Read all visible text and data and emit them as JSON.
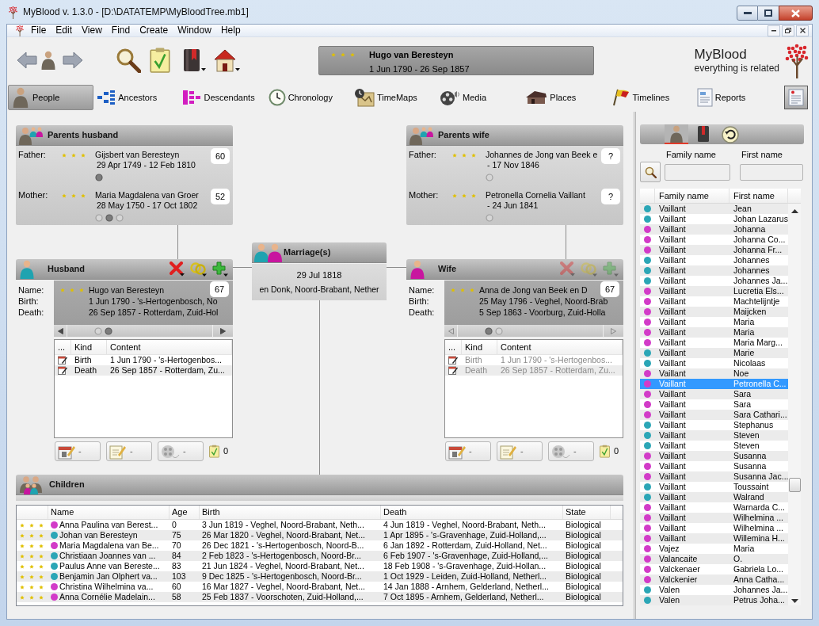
{
  "window": {
    "title": "MyBlood v. 1.3.0 - [D:\\DATATEMP\\MyBloodTree.mb1]"
  },
  "menu": [
    "File",
    "Edit",
    "View",
    "Find",
    "Create",
    "Window",
    "Help"
  ],
  "current_person": {
    "name": "Hugo van Beresteyn",
    "dates": "1 Jun 1790 - 26 Sep 1857"
  },
  "brand": {
    "name": "MyBlood",
    "tagline": "everything is related"
  },
  "tabs": [
    {
      "kind": "people",
      "label": "People",
      "selected": true
    },
    {
      "kind": "ancestors",
      "label": "Ancestors",
      "selected": false
    },
    {
      "kind": "descendants",
      "label": "Descendants",
      "selected": false
    },
    {
      "kind": "chronology",
      "label": "Chronology",
      "selected": false
    },
    {
      "kind": "timemaps",
      "label": "TimeMaps",
      "selected": false
    },
    {
      "kind": "media",
      "label": "Media",
      "selected": false
    },
    {
      "kind": "places",
      "label": "Places",
      "selected": false
    },
    {
      "kind": "timelines",
      "label": "Timelines",
      "selected": false
    },
    {
      "kind": "reports",
      "label": "Reports",
      "selected": false
    }
  ],
  "parents_husband": {
    "title": "Parents husband",
    "rows": [
      {
        "label": "Father:",
        "name": "Gijsbert van Beresteyn",
        "dates": "29 Apr 1749 - 12 Feb 1810",
        "age": "60",
        "pages": [
          {
            "selected": true
          }
        ]
      },
      {
        "label": "Mother:",
        "name": "Maria Magdalena van Groer",
        "dates": "28 May 1750 - 17 Oct 1802",
        "age": "52",
        "pages": [
          {
            "selected": false
          },
          {
            "selected": true
          },
          {
            "selected": false
          }
        ]
      }
    ]
  },
  "parents_wife": {
    "title": "Parents wife",
    "rows": [
      {
        "label": "Father:",
        "name": "Johannes de Jong van Beek e",
        "dates": "- 17 Nov 1846",
        "age": "?",
        "pages": [
          {
            "selected": false
          }
        ]
      },
      {
        "label": "Mother:",
        "name": "Petronella Cornelia Vaillant",
        "dates": "- 24 Jun 1841",
        "age": "?",
        "pages": [
          {
            "selected": false
          }
        ]
      }
    ]
  },
  "marriage": {
    "title": "Marriage(s)",
    "date": "29 Jul 1818",
    "place": "en Donk, Noord-Brabant, Nether"
  },
  "husband": {
    "title": "Husband",
    "disabled": false,
    "labels": [
      "Name:",
      "Birth:",
      "Death:"
    ],
    "lines": [
      "Hugo van Beresteyn",
      "1 Jun 1790 - 's-Hertogenbosch, No",
      "26 Sep 1857 - Rotterdam, Zuid-Hol"
    ],
    "age": "67",
    "pages": [
      {
        "selected": false
      },
      {
        "selected": true
      }
    ],
    "events": {
      "columns": [
        "...",
        "Kind",
        "Content"
      ],
      "rows": [
        {
          "event": "Birth",
          "content": "1 Jun 1790 - 's-Hertogenbos..."
        },
        {
          "event": "Death",
          "content": "26 Sep 1857 - Rotterdam, Zu..."
        }
      ]
    },
    "buttons": [
      {
        "kind": "event",
        "label": "-"
      },
      {
        "kind": "note",
        "label": "-"
      },
      {
        "kind": "media",
        "label": "-"
      }
    ],
    "tasks": "0"
  },
  "wife": {
    "title": "Wife",
    "disabled": true,
    "labels": [
      "Name:",
      "Birth:",
      "Death:"
    ],
    "lines": [
      "Anna de Jong van Beek en D",
      "25 May 1796 - Veghel, Noord-Brab",
      "5 Sep 1863 - Voorburg, Zuid-Holla"
    ],
    "age": "67",
    "pages": [
      {
        "selected": true
      },
      {
        "selected": false
      }
    ],
    "events": {
      "columns": [
        "...",
        "Kind",
        "Content"
      ],
      "rows": [
        {
          "event": "Birth",
          "content": "1 Jun 1790 - 's-Hertogenbos..."
        },
        {
          "event": "Death",
          "content": "26 Sep 1857 - Rotterdam, Zu..."
        }
      ]
    },
    "buttons": [
      {
        "kind": "event",
        "label": "-"
      },
      {
        "kind": "note",
        "label": "-"
      },
      {
        "kind": "media",
        "label": "-"
      }
    ],
    "tasks": "0"
  },
  "children": {
    "title": "Children",
    "columns": [
      "Name",
      "Age",
      "Birth",
      "Death",
      "State"
    ],
    "rows": [
      {
        "name": "Anna Paulina van Berest...",
        "age": "0",
        "birth": "3 Jun 1819 - Veghel, Noord-Brabant, Neth...",
        "death": "4 Jun 1819 - Veghel, Noord-Brabant, Neth...",
        "state": "Biological",
        "color": "#d23bc8"
      },
      {
        "name": "Johan van Beresteyn",
        "age": "75",
        "birth": "26 Mar 1820 - Veghel, Noord-Brabant, Net...",
        "death": "1 Apr 1895 - 's-Gravenhage, Zuid-Holland,...",
        "state": "Biological",
        "color": "#2ba6b6"
      },
      {
        "name": "Maria Magdalena van Be...",
        "age": "70",
        "birth": "26 Dec 1821 - 's-Hertogenbosch, Noord-B...",
        "death": "6 Jan 1892 - Rotterdam, Zuid-Holland, Net...",
        "state": "Biological",
        "color": "#d23bc8"
      },
      {
        "name": "Christiaan Joannes van ...",
        "age": "84",
        "birth": "2 Feb 1823 - 's-Hertogenbosch, Noord-Br...",
        "death": "6 Feb 1907 - 's-Gravenhage, Zuid-Holland,...",
        "state": "Biological",
        "color": "#2ba6b6"
      },
      {
        "name": "Paulus Anne van Bereste...",
        "age": "83",
        "birth": "21 Jun 1824 - Veghel, Noord-Brabant, Net...",
        "death": "18 Feb 1908 - 's-Gravenhage, Zuid-Hollan...",
        "state": "Biological",
        "color": "#2ba6b6"
      },
      {
        "name": "Benjamin Jan Olphert va...",
        "age": "103",
        "birth": "9 Dec 1825 - 's-Hertogenbosch, Noord-Br...",
        "death": "1 Oct 1929 - Leiden, Zuid-Holland, Netherl...",
        "state": "Biological",
        "color": "#2ba6b6"
      },
      {
        "name": "Christina Wilhelmina va...",
        "age": "60",
        "birth": "16 Mar 1827 - Veghel, Noord-Brabant, Net...",
        "death": "14 Jan 1888 - Arnhem, Gelderland, Netherl...",
        "state": "Biological",
        "color": "#d23bc8"
      },
      {
        "name": "Anna Cornélie Madelain...",
        "age": "58",
        "birth": "25 Feb 1837 - Voorschoten, Zuid-Holland,...",
        "death": "7 Oct 1895 - Arnhem, Gelderland, Netherl...",
        "state": "Biological",
        "color": "#d23bc8"
      }
    ]
  },
  "sidebar": {
    "tabs": [
      {
        "kind": "people",
        "selected": true
      },
      {
        "kind": "sources",
        "selected": false
      },
      {
        "kind": "history",
        "selected": false
      }
    ],
    "fields": [
      {
        "label": "Family name"
      },
      {
        "label": "First name"
      }
    ],
    "list": {
      "columns": [
        "Family name",
        "First name"
      ],
      "rows": [
        {
          "family": "Vaillant",
          "first": "Jean",
          "color": "#2ba6b6",
          "selected": false
        },
        {
          "family": "Vaillant",
          "first": "Johan Lazarus",
          "color": "#2ba6b6",
          "selected": false
        },
        {
          "family": "Vaillant",
          "first": "Johanna",
          "color": "#d23bc8",
          "selected": false
        },
        {
          "family": "Vaillant",
          "first": "Johanna Co...",
          "color": "#d23bc8",
          "selected": false
        },
        {
          "family": "Vaillant",
          "first": "Johanna Fr...",
          "color": "#d23bc8",
          "selected": false
        },
        {
          "family": "Vaillant",
          "first": "Johannes",
          "color": "#2ba6b6",
          "selected": false
        },
        {
          "family": "Vaillant",
          "first": "Johannes",
          "color": "#2ba6b6",
          "selected": false
        },
        {
          "family": "Vaillant",
          "first": "Johannes Ja...",
          "color": "#2ba6b6",
          "selected": false
        },
        {
          "family": "Vaillant",
          "first": "Lucretia Els...",
          "color": "#d23bc8",
          "selected": false
        },
        {
          "family": "Vaillant",
          "first": "Machtelijntje",
          "color": "#d23bc8",
          "selected": false
        },
        {
          "family": "Vaillant",
          "first": "Maijcken",
          "color": "#d23bc8",
          "selected": false
        },
        {
          "family": "Vaillant",
          "first": "Maria",
          "color": "#d23bc8",
          "selected": false
        },
        {
          "family": "Vaillant",
          "first": "Maria",
          "color": "#d23bc8",
          "selected": false
        },
        {
          "family": "Vaillant",
          "first": "Maria Marg...",
          "color": "#d23bc8",
          "selected": false
        },
        {
          "family": "Vaillant",
          "first": "Marie",
          "color": "#2ba6b6",
          "selected": false
        },
        {
          "family": "Vaillant",
          "first": "Nicolaas",
          "color": "#2ba6b6",
          "selected": false
        },
        {
          "family": "Vaillant",
          "first": "Noe",
          "color": "#d23bc8",
          "selected": false
        },
        {
          "family": "Vaillant",
          "first": "Petronella C...",
          "color": "#d23bc8",
          "selected": true
        },
        {
          "family": "Vaillant",
          "first": "Sara",
          "color": "#d23bc8",
          "selected": false
        },
        {
          "family": "Vaillant",
          "first": "Sara",
          "color": "#d23bc8",
          "selected": false
        },
        {
          "family": "Vaillant",
          "first": "Sara Cathari...",
          "color": "#d23bc8",
          "selected": false
        },
        {
          "family": "Vaillant",
          "first": "Stephanus",
          "color": "#2ba6b6",
          "selected": false
        },
        {
          "family": "Vaillant",
          "first": "Steven",
          "color": "#2ba6b6",
          "selected": false
        },
        {
          "family": "Vaillant",
          "first": "Steven",
          "color": "#2ba6b6",
          "selected": false
        },
        {
          "family": "Vaillant",
          "first": "Susanna",
          "color": "#d23bc8",
          "selected": false
        },
        {
          "family": "Vaillant",
          "first": "Susanna",
          "color": "#d23bc8",
          "selected": false
        },
        {
          "family": "Vaillant",
          "first": "Susanna Jac...",
          "color": "#d23bc8",
          "selected": false
        },
        {
          "family": "Vaillant",
          "first": "Toussaint",
          "color": "#2ba6b6",
          "selected": false
        },
        {
          "family": "Vaillant",
          "first": "Walrand",
          "color": "#2ba6b6",
          "selected": false
        },
        {
          "family": "Vaillant",
          "first": "Warnarda C...",
          "color": "#d23bc8",
          "selected": false
        },
        {
          "family": "Vaillant",
          "first": "Wilhelmina ...",
          "color": "#d23bc8",
          "selected": false
        },
        {
          "family": "Vaillant",
          "first": "Wilhelmina ...",
          "color": "#d23bc8",
          "selected": false
        },
        {
          "family": "Vaillant",
          "first": "Willemina H...",
          "color": "#d23bc8",
          "selected": false
        },
        {
          "family": "Vajez",
          "first": "Maria",
          "color": "#d23bc8",
          "selected": false
        },
        {
          "family": "Valancaite",
          "first": "O.",
          "color": "#d23bc8",
          "selected": false
        },
        {
          "family": "Valckenaer",
          "first": "Gabriela Lo...",
          "color": "#d23bc8",
          "selected": false
        },
        {
          "family": "Valckenier",
          "first": "Anna Catha...",
          "color": "#d23bc8",
          "selected": false
        },
        {
          "family": "Valen",
          "first": "Johannes Ja...",
          "color": "#2ba6b6",
          "selected": false
        },
        {
          "family": "Valen",
          "first": "Petrus Joha...",
          "color": "#2ba6b6",
          "selected": false
        }
      ]
    }
  }
}
